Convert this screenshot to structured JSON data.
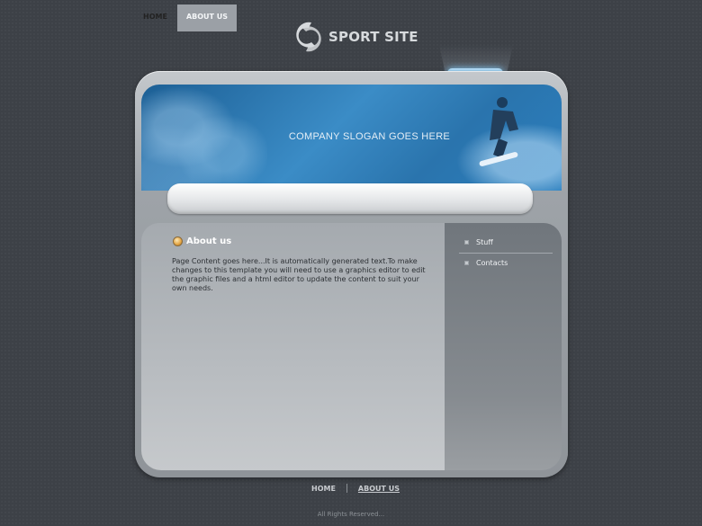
{
  "header": {
    "logo_text": "SPORT SITE",
    "slogan": "COMPANY SLOGAN GOES HERE"
  },
  "nav": {
    "items": [
      {
        "label": "HOME",
        "active": false
      },
      {
        "label": "ABOUT US",
        "active": true
      }
    ]
  },
  "main": {
    "title": "About us",
    "body": "Page Content goes here...It is automatically generated text.To make changes to this template you will need to use a graphics editor to edit the graphic files and a html editor to update the content to suit your own needs."
  },
  "sidebar": {
    "items": [
      {
        "label": "Stuff"
      },
      {
        "label": "Contacts"
      }
    ]
  },
  "footer": {
    "links": [
      {
        "label": "HOME"
      },
      {
        "label": "ABOUT US"
      }
    ],
    "copyright": "All Rights Reserved..."
  },
  "colors": {
    "background": "#3d4147",
    "banner": "#2a74ad",
    "active_tab": "#9ba0a6"
  }
}
